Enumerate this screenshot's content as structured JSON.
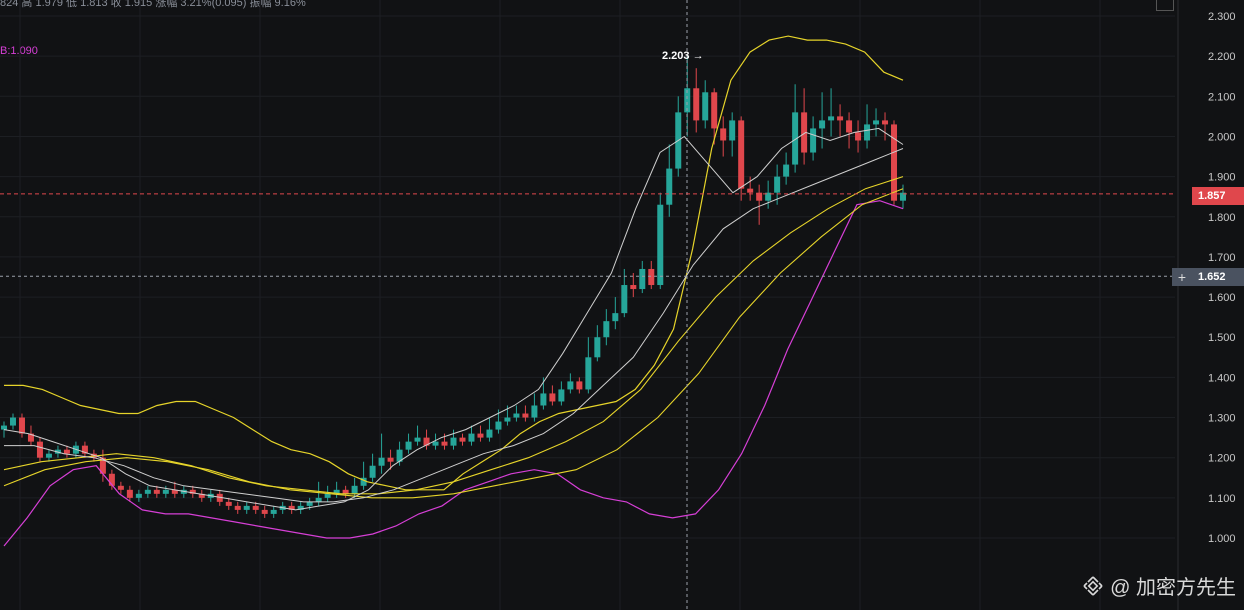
{
  "header": {
    "info_text": "824  高 1.979  低 1.813  收 1.915  涨幅 3.21%(0.095)  振幅 9.16%",
    "bb_label": "B:1.090"
  },
  "markers": {
    "peak_label": "2.203",
    "last_price_label": "1.857",
    "crosshair_label": "1.652"
  },
  "watermark": {
    "text": "@ 加密方先生"
  },
  "colors": {
    "background": "#111214",
    "up": "#26a69a",
    "down": "#e0474c",
    "bb_upper": "#e6d42a",
    "bb_lower": "#d63fd6",
    "ma": "#cfcfcf"
  },
  "chart_data": {
    "type": "candlestick",
    "ylim": [
      0.95,
      2.32
    ],
    "y_ticks": [
      1.0,
      1.1,
      1.2,
      1.3,
      1.4,
      1.5,
      1.6,
      1.7,
      1.8,
      1.9,
      2.0,
      2.1,
      2.2,
      2.3
    ],
    "y_tick_labels": [
      "1.000",
      "1.100",
      "1.200",
      "1.300",
      "1.400",
      "1.500",
      "1.600",
      "1.700",
      "1.800",
      "1.900",
      "2.000",
      "2.100",
      "2.200",
      "2.300"
    ],
    "grid": true,
    "last_price": 1.857,
    "crosshair_price": 1.652,
    "peak_high": 2.203,
    "candles": [
      [
        1.27,
        1.28,
        1.25,
        1.29
      ],
      [
        1.28,
        1.3,
        1.27,
        1.31
      ],
      [
        1.3,
        1.26,
        1.25,
        1.31
      ],
      [
        1.26,
        1.24,
        1.23,
        1.28
      ],
      [
        1.24,
        1.2,
        1.19,
        1.25
      ],
      [
        1.2,
        1.21,
        1.19,
        1.22
      ],
      [
        1.21,
        1.22,
        1.2,
        1.23
      ],
      [
        1.22,
        1.21,
        1.2,
        1.23
      ],
      [
        1.21,
        1.23,
        1.2,
        1.24
      ],
      [
        1.23,
        1.21,
        1.2,
        1.24
      ],
      [
        1.21,
        1.2,
        1.19,
        1.22
      ],
      [
        1.2,
        1.16,
        1.14,
        1.22
      ],
      [
        1.16,
        1.13,
        1.12,
        1.17
      ],
      [
        1.13,
        1.12,
        1.11,
        1.14
      ],
      [
        1.12,
        1.1,
        1.09,
        1.13
      ],
      [
        1.1,
        1.11,
        1.09,
        1.12
      ],
      [
        1.11,
        1.12,
        1.1,
        1.13
      ],
      [
        1.12,
        1.11,
        1.1,
        1.13
      ],
      [
        1.11,
        1.12,
        1.1,
        1.13
      ],
      [
        1.12,
        1.11,
        1.1,
        1.14
      ],
      [
        1.11,
        1.12,
        1.1,
        1.13
      ],
      [
        1.12,
        1.11,
        1.1,
        1.13
      ],
      [
        1.11,
        1.1,
        1.09,
        1.12
      ],
      [
        1.1,
        1.11,
        1.09,
        1.12
      ],
      [
        1.11,
        1.09,
        1.08,
        1.12
      ],
      [
        1.09,
        1.08,
        1.07,
        1.1
      ],
      [
        1.08,
        1.07,
        1.06,
        1.09
      ],
      [
        1.07,
        1.08,
        1.06,
        1.09
      ],
      [
        1.08,
        1.07,
        1.06,
        1.09
      ],
      [
        1.07,
        1.06,
        1.05,
        1.08
      ],
      [
        1.06,
        1.07,
        1.05,
        1.08
      ],
      [
        1.07,
        1.08,
        1.06,
        1.09
      ],
      [
        1.08,
        1.07,
        1.06,
        1.09
      ],
      [
        1.07,
        1.08,
        1.06,
        1.09
      ],
      [
        1.08,
        1.09,
        1.07,
        1.1
      ],
      [
        1.09,
        1.1,
        1.08,
        1.14
      ],
      [
        1.1,
        1.11,
        1.09,
        1.13
      ],
      [
        1.11,
        1.12,
        1.1,
        1.14
      ],
      [
        1.12,
        1.11,
        1.1,
        1.13
      ],
      [
        1.11,
        1.13,
        1.1,
        1.15
      ],
      [
        1.13,
        1.15,
        1.12,
        1.19
      ],
      [
        1.15,
        1.18,
        1.14,
        1.21
      ],
      [
        1.18,
        1.2,
        1.16,
        1.26
      ],
      [
        1.2,
        1.19,
        1.17,
        1.22
      ],
      [
        1.19,
        1.22,
        1.18,
        1.24
      ],
      [
        1.22,
        1.24,
        1.21,
        1.26
      ],
      [
        1.24,
        1.25,
        1.23,
        1.28
      ],
      [
        1.25,
        1.23,
        1.22,
        1.27
      ],
      [
        1.23,
        1.24,
        1.22,
        1.26
      ],
      [
        1.24,
        1.23,
        1.22,
        1.26
      ],
      [
        1.23,
        1.25,
        1.22,
        1.27
      ],
      [
        1.25,
        1.24,
        1.23,
        1.26
      ],
      [
        1.24,
        1.26,
        1.23,
        1.28
      ],
      [
        1.26,
        1.25,
        1.24,
        1.28
      ],
      [
        1.25,
        1.27,
        1.24,
        1.3
      ],
      [
        1.27,
        1.29,
        1.26,
        1.32
      ],
      [
        1.29,
        1.3,
        1.28,
        1.33
      ],
      [
        1.3,
        1.31,
        1.29,
        1.33
      ],
      [
        1.31,
        1.3,
        1.29,
        1.33
      ],
      [
        1.3,
        1.33,
        1.29,
        1.36
      ],
      [
        1.33,
        1.36,
        1.32,
        1.4
      ],
      [
        1.36,
        1.34,
        1.33,
        1.38
      ],
      [
        1.34,
        1.37,
        1.33,
        1.39
      ],
      [
        1.37,
        1.39,
        1.36,
        1.41
      ],
      [
        1.39,
        1.37,
        1.36,
        1.4
      ],
      [
        1.37,
        1.45,
        1.36,
        1.5
      ],
      [
        1.45,
        1.5,
        1.44,
        1.53
      ],
      [
        1.5,
        1.54,
        1.48,
        1.57
      ],
      [
        1.54,
        1.56,
        1.52,
        1.6
      ],
      [
        1.56,
        1.63,
        1.55,
        1.67
      ],
      [
        1.63,
        1.62,
        1.6,
        1.66
      ],
      [
        1.62,
        1.67,
        1.61,
        1.69
      ],
      [
        1.67,
        1.63,
        1.62,
        1.69
      ],
      [
        1.63,
        1.83,
        1.62,
        1.86
      ],
      [
        1.83,
        1.92,
        1.8,
        1.98
      ],
      [
        1.92,
        2.06,
        1.9,
        2.1
      ],
      [
        2.06,
        2.12,
        2.0,
        2.203
      ],
      [
        2.12,
        2.04,
        2.01,
        2.17
      ],
      [
        2.04,
        2.11,
        2.02,
        2.14
      ],
      [
        2.11,
        2.02,
        1.98,
        2.12
      ],
      [
        2.02,
        1.99,
        1.95,
        2.05
      ],
      [
        1.99,
        2.04,
        1.95,
        2.06
      ],
      [
        2.04,
        1.87,
        1.84,
        2.05
      ],
      [
        1.87,
        1.86,
        1.84,
        1.9
      ],
      [
        1.86,
        1.84,
        1.78,
        1.88
      ],
      [
        1.84,
        1.86,
        1.82,
        1.89
      ],
      [
        1.86,
        1.9,
        1.83,
        1.93
      ],
      [
        1.9,
        1.93,
        1.88,
        1.96
      ],
      [
        1.93,
        2.06,
        1.91,
        2.13
      ],
      [
        2.06,
        1.96,
        1.93,
        2.12
      ],
      [
        1.96,
        2.02,
        1.94,
        2.05
      ],
      [
        2.02,
        2.04,
        1.97,
        2.11
      ],
      [
        2.04,
        2.05,
        2.0,
        2.12
      ],
      [
        2.05,
        2.04,
        2.0,
        2.08
      ],
      [
        2.04,
        2.01,
        1.97,
        2.06
      ],
      [
        2.01,
        1.99,
        1.96,
        2.04
      ],
      [
        1.99,
        2.03,
        1.97,
        2.08
      ],
      [
        2.03,
        2.04,
        2.0,
        2.07
      ],
      [
        2.04,
        2.03,
        1.99,
        2.06
      ],
      [
        2.03,
        1.84,
        1.83,
        2.04
      ],
      [
        1.84,
        1.86,
        1.82,
        1.88
      ]
    ],
    "bb_upper": [
      1.38,
      1.38,
      1.37,
      1.35,
      1.33,
      1.32,
      1.31,
      1.31,
      1.33,
      1.34,
      1.34,
      1.32,
      1.3,
      1.27,
      1.24,
      1.22,
      1.21,
      1.19,
      1.16,
      1.14,
      1.13,
      1.12,
      1.12,
      1.12,
      1.16,
      1.19,
      1.22,
      1.26,
      1.29,
      1.31,
      1.32,
      1.33,
      1.34,
      1.37,
      1.43,
      1.52,
      1.72,
      1.97,
      2.14,
      2.21,
      2.24,
      2.25,
      2.24,
      2.24,
      2.23,
      2.21,
      2.16,
      2.14
    ],
    "bb_lower": [
      0.98,
      1.05,
      1.13,
      1.17,
      1.18,
      1.11,
      1.07,
      1.06,
      1.06,
      1.05,
      1.04,
      1.03,
      1.02,
      1.01,
      1.0,
      1.0,
      1.01,
      1.03,
      1.06,
      1.08,
      1.12,
      1.14,
      1.16,
      1.17,
      1.16,
      1.12,
      1.1,
      1.09,
      1.06,
      1.05,
      1.06,
      1.12,
      1.21,
      1.33,
      1.47,
      1.59,
      1.71,
      1.83,
      1.84,
      1.82
    ],
    "ma_fast": [
      1.27,
      1.26,
      1.24,
      1.22,
      1.2,
      1.16,
      1.13,
      1.12,
      1.11,
      1.1,
      1.09,
      1.08,
      1.07,
      1.08,
      1.09,
      1.12,
      1.18,
      1.22,
      1.25,
      1.27,
      1.3,
      1.33,
      1.37,
      1.46,
      1.56,
      1.66,
      1.82,
      1.96,
      2.0,
      1.93,
      1.86,
      1.9,
      1.97,
      2.01,
      1.99,
      2.01,
      2.02,
      1.98
    ],
    "ma_slow": [
      1.23,
      1.23,
      1.21,
      1.2,
      1.18,
      1.15,
      1.13,
      1.12,
      1.11,
      1.1,
      1.09,
      1.09,
      1.1,
      1.12,
      1.15,
      1.18,
      1.21,
      1.23,
      1.26,
      1.31,
      1.38,
      1.45,
      1.56,
      1.68,
      1.77,
      1.82,
      1.85,
      1.88,
      1.91,
      1.94,
      1.97
    ],
    "ma_yellow_1": [
      1.17,
      1.19,
      1.2,
      1.21,
      1.2,
      1.18,
      1.15,
      1.13,
      1.12,
      1.11,
      1.11,
      1.12,
      1.14,
      1.17,
      1.2,
      1.24,
      1.29,
      1.37,
      1.49,
      1.6,
      1.69,
      1.76,
      1.82,
      1.87,
      1.9
    ],
    "ma_yellow_2": [
      1.13,
      1.17,
      1.19,
      1.2,
      1.19,
      1.17,
      1.14,
      1.12,
      1.11,
      1.1,
      1.1,
      1.11,
      1.13,
      1.15,
      1.17,
      1.22,
      1.3,
      1.41,
      1.55,
      1.66,
      1.75,
      1.83,
      1.87
    ]
  }
}
